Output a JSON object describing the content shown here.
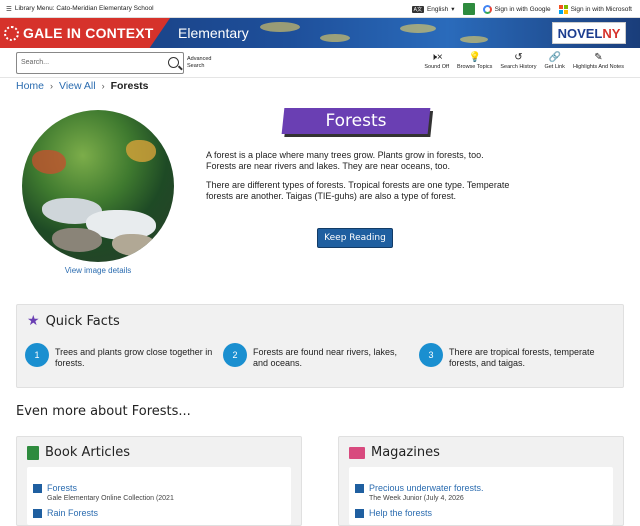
{
  "topbar": {
    "library": "Library Menu: Cato-Meridian Elementary School",
    "language": "English",
    "google": "Sign in with Google",
    "microsoft": "Sign in with Microsoft"
  },
  "banner": {
    "brand": "GALE IN CONTEXT",
    "level": "Elementary",
    "partner_a": "NOVEL",
    "partner_b": "NY"
  },
  "toolbar": {
    "search_placeholder": "Search...",
    "advanced": "Advanced Search",
    "tools": [
      "Sound Off",
      "Browse Topics",
      "Search History",
      "Get Link",
      "Highlights And Notes"
    ]
  },
  "breadcrumb": {
    "home": "Home",
    "view_all": "View All",
    "current": "Forests"
  },
  "topic": {
    "title": "Forests",
    "p1": "A forest is a place where many trees grow. Plants grow in forests, too. Forests are near rivers and lakes. They are near oceans, too.",
    "p2": "There are different types of forests. Tropical forests are one type. Temperate forests are another. Taigas (TIE-guhs) are also a type of forest.",
    "keep_reading": "Keep Reading",
    "view_image": "View image details"
  },
  "quick_facts": {
    "heading": "Quick Facts",
    "items": [
      {
        "num": "1",
        "text": "Trees and plants grow close together in forests."
      },
      {
        "num": "2",
        "text": "Forests are found near rivers, lakes, and oceans."
      },
      {
        "num": "3",
        "text": "There are tropical forests, temperate forests, and taigas."
      }
    ]
  },
  "more_heading": "Even more about Forests...",
  "book_articles": {
    "heading": "Book Articles",
    "items": [
      {
        "title": "Forests",
        "source": "Gale Elementary Online Collection (2021"
      },
      {
        "title": "Rain Forests",
        "source": ""
      }
    ]
  },
  "magazines": {
    "heading": "Magazines",
    "items": [
      {
        "title": "Precious underwater forests.",
        "source": "The Week Junior (July 4, 2026"
      },
      {
        "title": "Help the forests",
        "source": ""
      }
    ]
  },
  "colors": {
    "brand_red": "#d6322b",
    "accent_purple": "#6a3fb3",
    "link_blue": "#2b6cb0",
    "fact_blue": "#1a8fd0"
  }
}
